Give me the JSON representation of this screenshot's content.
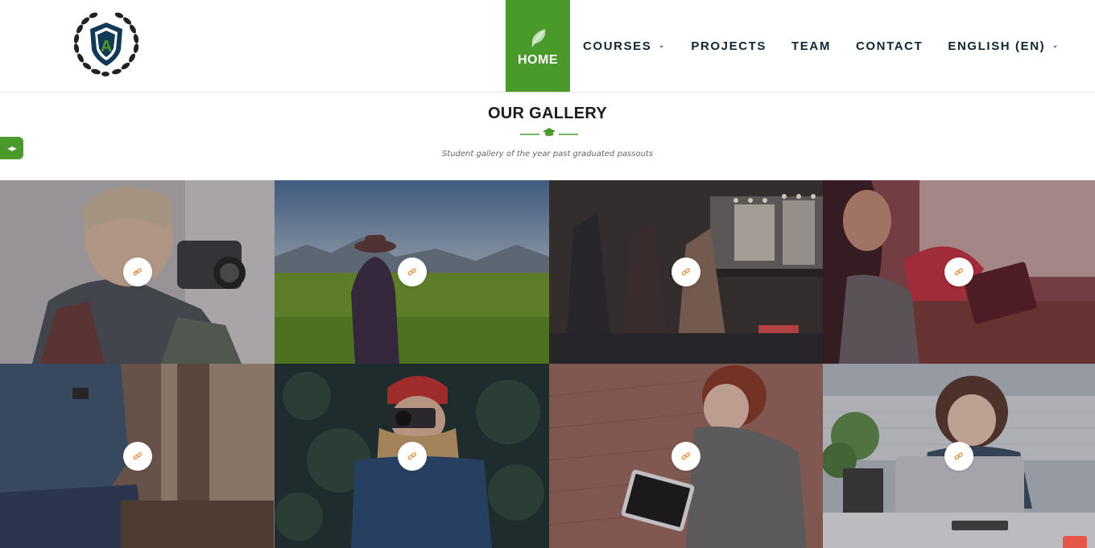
{
  "nav": {
    "home": "HOME",
    "courses": "COURSES",
    "projects": "PROJECTS",
    "team": "TEAM",
    "contact": "CONTACT",
    "language": "ENGLISH (EN)"
  },
  "logo_letter": "A",
  "gallery": {
    "title": "OUR GALLERY",
    "subtitle": "Student gallery of the year past graduated passouts",
    "items_count_rows": 2,
    "items": [
      {
        "subject": "man-with-camera",
        "icon": "link-icon"
      },
      {
        "subject": "woman-in-field",
        "icon": "link-icon"
      },
      {
        "subject": "backstage-dressing-room",
        "icon": "link-icon"
      },
      {
        "subject": "woman-with-tablet-red-chair",
        "icon": "link-icon"
      },
      {
        "subject": "man-sitting-forest",
        "icon": "link-icon"
      },
      {
        "subject": "girl-red-beanie-camera",
        "icon": "link-icon"
      },
      {
        "subject": "woman-reading-tablet",
        "icon": "link-icon"
      },
      {
        "subject": "woman-with-laptop",
        "icon": "link-icon"
      }
    ]
  },
  "colors": {
    "brand_green": "#4a9a2b",
    "nav_text": "#0f2637",
    "link_icon": "#e8893a",
    "scroll_top": "#e5574b"
  }
}
